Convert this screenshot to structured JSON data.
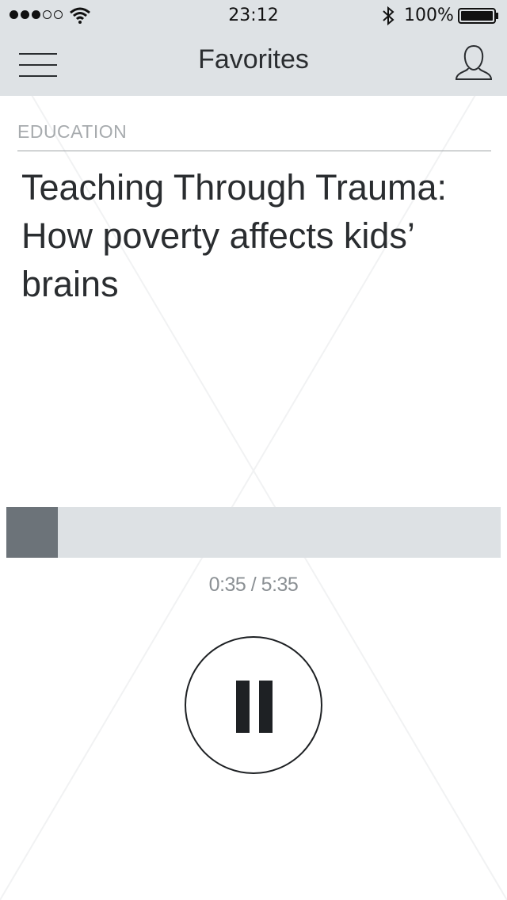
{
  "status_bar": {
    "time": "23:12",
    "battery_percent": "100%",
    "signal_bars_filled": 3,
    "signal_bars_total": 5,
    "icons": [
      "wifi-icon",
      "bluetooth-icon",
      "battery-icon"
    ]
  },
  "nav": {
    "title": "Favorites",
    "left_icon": "menu-icon",
    "right_icon": "profile-icon"
  },
  "story": {
    "category": "EDUCATION",
    "title": "Teaching Through Trauma: How poverty affects kids’ brains"
  },
  "player": {
    "time_display": "0:35 / 5:35",
    "progress_fraction": 0.104,
    "control_icon": "pause-icon"
  },
  "colors": {
    "bar_background": "#dee2e5",
    "progress_fill": "#6c7379",
    "progress_track": "#dde1e4",
    "category_text": "#a7abae"
  }
}
